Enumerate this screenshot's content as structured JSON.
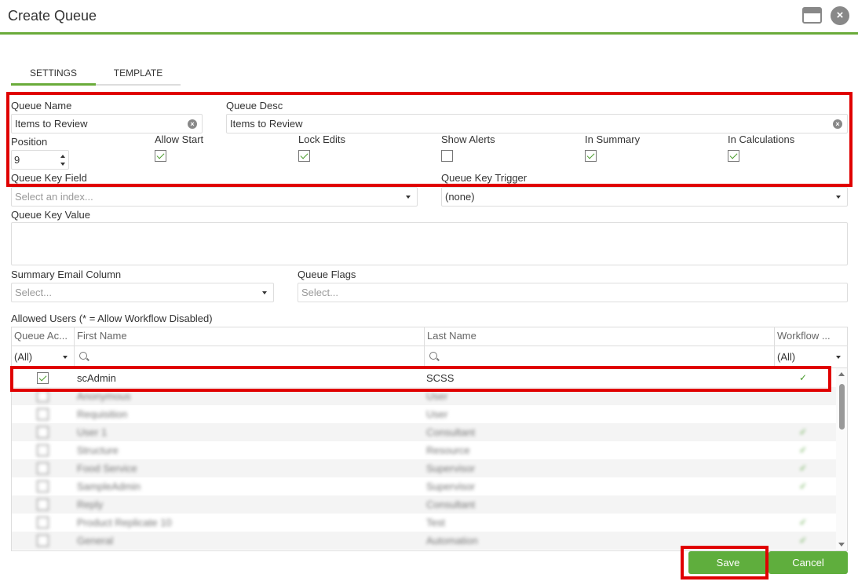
{
  "window": {
    "title": "Create Queue"
  },
  "tabs": [
    {
      "label": "SETTINGS"
    },
    {
      "label": "TEMPLATE"
    }
  ],
  "form": {
    "queue_name": {
      "label": "Queue Name",
      "value": "Items to Review"
    },
    "queue_desc": {
      "label": "Queue Desc",
      "value": "Items to Review"
    },
    "position": {
      "label": "Position",
      "value": "9"
    },
    "allow_start": {
      "label": "Allow Start",
      "checked": true
    },
    "lock_edits": {
      "label": "Lock Edits",
      "checked": true
    },
    "show_alerts": {
      "label": "Show Alerts",
      "checked": false
    },
    "in_summary": {
      "label": "In Summary",
      "checked": true
    },
    "in_calculations": {
      "label": "In Calculations",
      "checked": true
    },
    "queue_key_field": {
      "label": "Queue Key Field",
      "placeholder": "Select an index..."
    },
    "queue_key_trigger": {
      "label": "Queue Key Trigger",
      "value": "(none)"
    },
    "queue_key_value": {
      "label": "Queue Key Value",
      "value": ""
    },
    "summary_email_column": {
      "label": "Summary Email Column",
      "placeholder": "Select..."
    },
    "queue_flags": {
      "label": "Queue Flags",
      "placeholder": "Select..."
    }
  },
  "users_grid": {
    "label": "Allowed Users (* = Allow Workflow Disabled)",
    "columns": [
      "Queue Ac...",
      "First Name",
      "Last Name",
      "Workflow ..."
    ],
    "filters": {
      "queue_access": "(All)",
      "workflow": "(All)"
    },
    "rows": [
      {
        "first_name": "scAdmin",
        "last_name": "SCSS",
        "access": true,
        "workflow": true
      },
      {
        "first_name": "Anonymous",
        "last_name": "User",
        "access": false,
        "workflow": false
      },
      {
        "first_name": "Requisition",
        "last_name": "User",
        "access": false,
        "workflow": false
      },
      {
        "first_name": "User 1",
        "last_name": "Consultant",
        "access": false,
        "workflow": true
      },
      {
        "first_name": "Structure",
        "last_name": "Resource",
        "access": false,
        "workflow": true
      },
      {
        "first_name": "Food Service",
        "last_name": "Supervisor",
        "access": false,
        "workflow": true
      },
      {
        "first_name": "SampleAdmin",
        "last_name": "Supervisor",
        "access": false,
        "workflow": true
      },
      {
        "first_name": "Reply",
        "last_name": "Consultant",
        "access": false,
        "workflow": false
      },
      {
        "first_name": "Product Replicate 10",
        "last_name": "Test",
        "access": false,
        "workflow": true
      },
      {
        "first_name": "General",
        "last_name": "Automation",
        "access": false,
        "workflow": true
      }
    ]
  },
  "buttons": {
    "save": "Save",
    "cancel": "Cancel"
  },
  "colors": {
    "accent": "#6aab3a",
    "button": "#5fae3d",
    "highlight": "#e00000"
  }
}
